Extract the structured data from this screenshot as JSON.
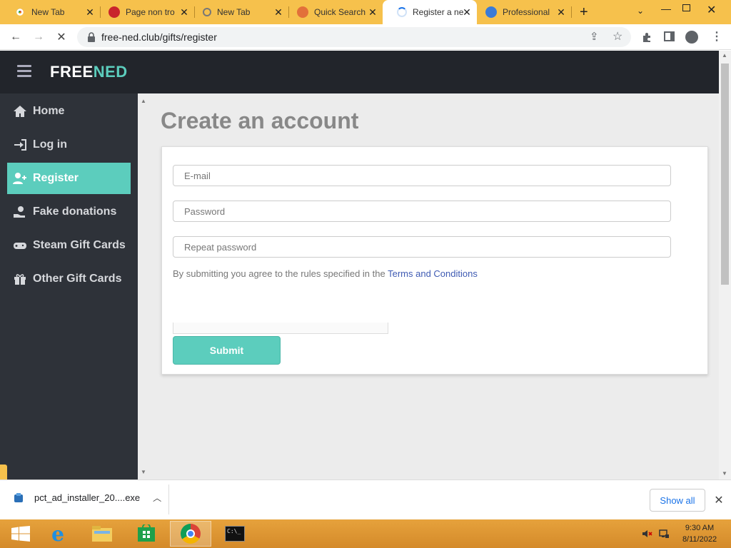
{
  "browser": {
    "tabs": [
      {
        "label": "New Tab",
        "icon": "chrome-icon"
      },
      {
        "label": "Page non tro",
        "icon": "opera-icon"
      },
      {
        "label": "New Tab",
        "icon": "search-icon"
      },
      {
        "label": "Quick Search",
        "icon": "quicksearch-icon"
      },
      {
        "label": "Register a ne",
        "icon": "loading-icon"
      },
      {
        "label": "Professional",
        "icon": "edge-icon"
      }
    ],
    "active_tab_index": 4,
    "url": "free-ned.club/gifts/register"
  },
  "site": {
    "logo_part1": "FREE",
    "logo_part2": "NED",
    "accent_color": "#5ccdbd",
    "nav": [
      {
        "label": "Home",
        "icon": "home-icon"
      },
      {
        "label": "Log in",
        "icon": "sign-in-icon"
      },
      {
        "label": "Register",
        "icon": "user-plus-icon"
      },
      {
        "label": "Fake donations",
        "icon": "donate-icon"
      },
      {
        "label": "Steam Gift Cards",
        "icon": "gamepad-icon"
      },
      {
        "label": "Other Gift Cards",
        "icon": "gift-icon"
      }
    ],
    "active_nav_index": 2
  },
  "form": {
    "title": "Create an account",
    "email_placeholder": "E-mail",
    "password_placeholder": "Password",
    "repeat_password_placeholder": "Repeat password",
    "agree_text": "By submitting you agree to the rules specified in the ",
    "terms_link": "Terms and Conditions",
    "submit_label": "Submit"
  },
  "downloads": {
    "filename": "pct_ad_installer_20....exe",
    "show_all_label": "Show all"
  },
  "taskbar": {
    "time": "9:30 AM",
    "date": "8/11/2022",
    "apps": [
      "start-icon",
      "ie-icon",
      "explorer-icon",
      "store-icon",
      "chrome-icon",
      "cmd-icon"
    ]
  }
}
